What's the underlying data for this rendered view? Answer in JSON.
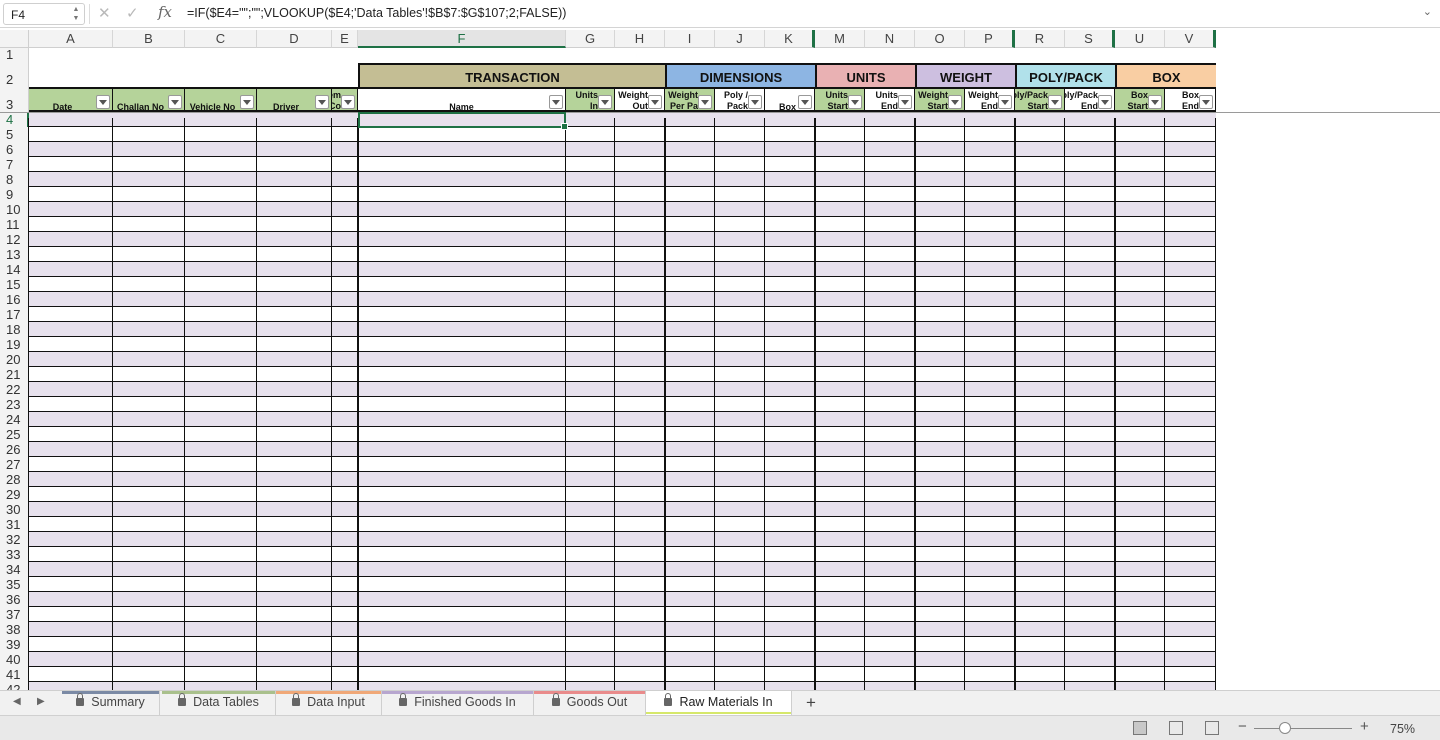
{
  "formula_bar": {
    "name_box": "F4",
    "formula": "=IF($E4=\"\";\"\";VLOOKUP($E4;'Data Tables'!$B$7:$G$107;2;FALSE))",
    "cancel_icon": "x-icon",
    "enter_icon": "check-icon",
    "fx_label": "fx"
  },
  "columns": [
    "A",
    "B",
    "C",
    "D",
    "E",
    "F",
    "G",
    "H",
    "I",
    "J",
    "K",
    "M",
    "N",
    "O",
    "P",
    "R",
    "S",
    "U",
    "V"
  ],
  "rows": [
    "1",
    "2",
    "3",
    "4",
    "5",
    "6",
    "7",
    "8",
    "9",
    "10",
    "11",
    "12",
    "13",
    "14",
    "15",
    "16",
    "17",
    "18",
    "19",
    "20",
    "21",
    "22",
    "23",
    "24",
    "25",
    "26",
    "27",
    "28",
    "29",
    "30",
    "31",
    "32",
    "33",
    "34",
    "35",
    "36",
    "37",
    "38",
    "39",
    "40",
    "41",
    "42"
  ],
  "categories": [
    {
      "label": "TRANSACTION",
      "color": "#c4be94"
    },
    {
      "label": "DIMENSIONS",
      "color": "#8db5e3"
    },
    {
      "label": "UNITS",
      "color": "#e9b1b3"
    },
    {
      "label": "WEIGHT",
      "color": "#cdbfe0"
    },
    {
      "label": "POLY/PACK",
      "color": "#b1e1ea"
    },
    {
      "label": "BOX",
      "color": "#f9cea3"
    }
  ],
  "headers": {
    "date": "Date",
    "challan": "Challan No",
    "vehicle": "Vehicle No",
    "driver": "Driver",
    "item_l1": "Item",
    "item_l2": "Co",
    "name": "Name",
    "units_in_l1": "Units",
    "units_in_l2": "In",
    "weight_out_l1": "Weight",
    "weight_out_l2": "Out",
    "wpp_l1": "Weight",
    "wpp_l2": "Per Pa",
    "poly_l1": "Poly /",
    "poly_l2": "Pack",
    "box": "Box",
    "units_start_l1": "Units",
    "units_start_l2": "Start",
    "units_end_l1": "Units",
    "units_end_l2": "End",
    "weight_start_l1": "Weight",
    "weight_start_l2": "Start",
    "weight_end_l1": "Weight",
    "weight_end_l2": "End",
    "pp_start_l1": "Poly/Pack",
    "pp_start_l2": "Start",
    "pp_end_l1": "Poly/Pack",
    "pp_end_l2": "End",
    "box_start_l1": "Box",
    "box_start_l2": "Start",
    "box_end_l1": "Box",
    "box_end_l2": "End"
  },
  "sheet_tabs": [
    {
      "label": "Summary",
      "color": "#7b8aa5"
    },
    {
      "label": "Data Tables",
      "color": "#a9c08c"
    },
    {
      "label": "Data Input",
      "color": "#f0a878"
    },
    {
      "label": "Finished Goods In",
      "color": "#b7a6cf"
    },
    {
      "label": "Goods Out",
      "color": "#e98b8b"
    },
    {
      "label": "Raw Materials In",
      "color": "#ffffff"
    }
  ],
  "status": {
    "zoom": "75%",
    "zoom_level": 0.32
  },
  "colors": {
    "header_green": "#b5d39a",
    "band_purple": "#e7e1ed",
    "accent": "#1e7145"
  }
}
